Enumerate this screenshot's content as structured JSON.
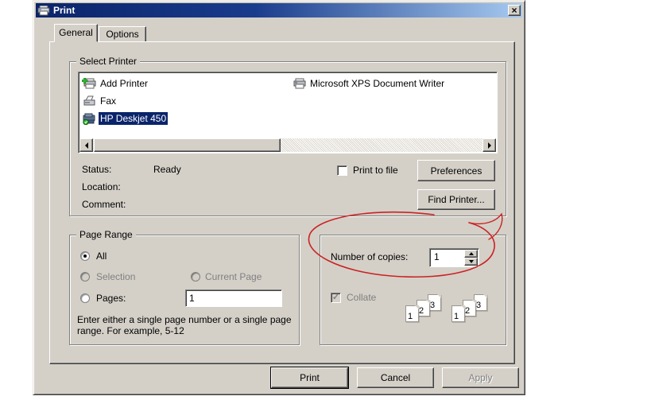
{
  "window": {
    "title": "Print",
    "close_glyph": "×"
  },
  "tabs": [
    {
      "label": "General",
      "active": true
    },
    {
      "label": "Options",
      "active": false
    }
  ],
  "select_printer": {
    "group_label": "Select Printer",
    "printers": [
      {
        "name": "Add Printer",
        "icon": "add-printer-icon"
      },
      {
        "name": "Fax",
        "icon": "fax-icon"
      },
      {
        "name": "HP Deskjet 450",
        "icon": "default-printer-icon",
        "selected": true
      },
      {
        "name": "Microsoft XPS Document Writer",
        "icon": "printer-icon"
      }
    ],
    "status_label": "Status:",
    "status_value": "Ready",
    "location_label": "Location:",
    "location_value": "",
    "comment_label": "Comment:",
    "comment_value": "",
    "print_to_file_label": "Print to file",
    "print_to_file_checked": false,
    "preferences_button": "Preferences",
    "find_printer_button": "Find Printer..."
  },
  "page_range": {
    "group_label": "Page Range",
    "all_label": "All",
    "all_selected": true,
    "selection_label": "Selection",
    "current_page_label": "Current Page",
    "pages_label": "Pages:",
    "pages_value": "1",
    "help_text": "Enter either a single page number or a single page range.  For example, 5-12"
  },
  "copies": {
    "number_of_copies_label": "Number of copies:",
    "number_of_copies_value": "1",
    "collate_label": "Collate",
    "collate_checked": true,
    "collate_check_glyph": "✓",
    "collate_page_numbers": [
      "1",
      "2",
      "3"
    ]
  },
  "actions": {
    "print_button": "Print",
    "cancel_button": "Cancel",
    "apply_button": "Apply"
  },
  "annotation": {
    "type": "hand-drawn-red-ellipse",
    "target": "number-of-copies",
    "color": "#cc2222"
  },
  "colors": {
    "titlebar_start": "#0a246a",
    "titlebar_end": "#a6caf0",
    "dialog_face": "#d4d0c8",
    "selection_bg": "#0a246a",
    "annotation_red": "#cc2222"
  }
}
